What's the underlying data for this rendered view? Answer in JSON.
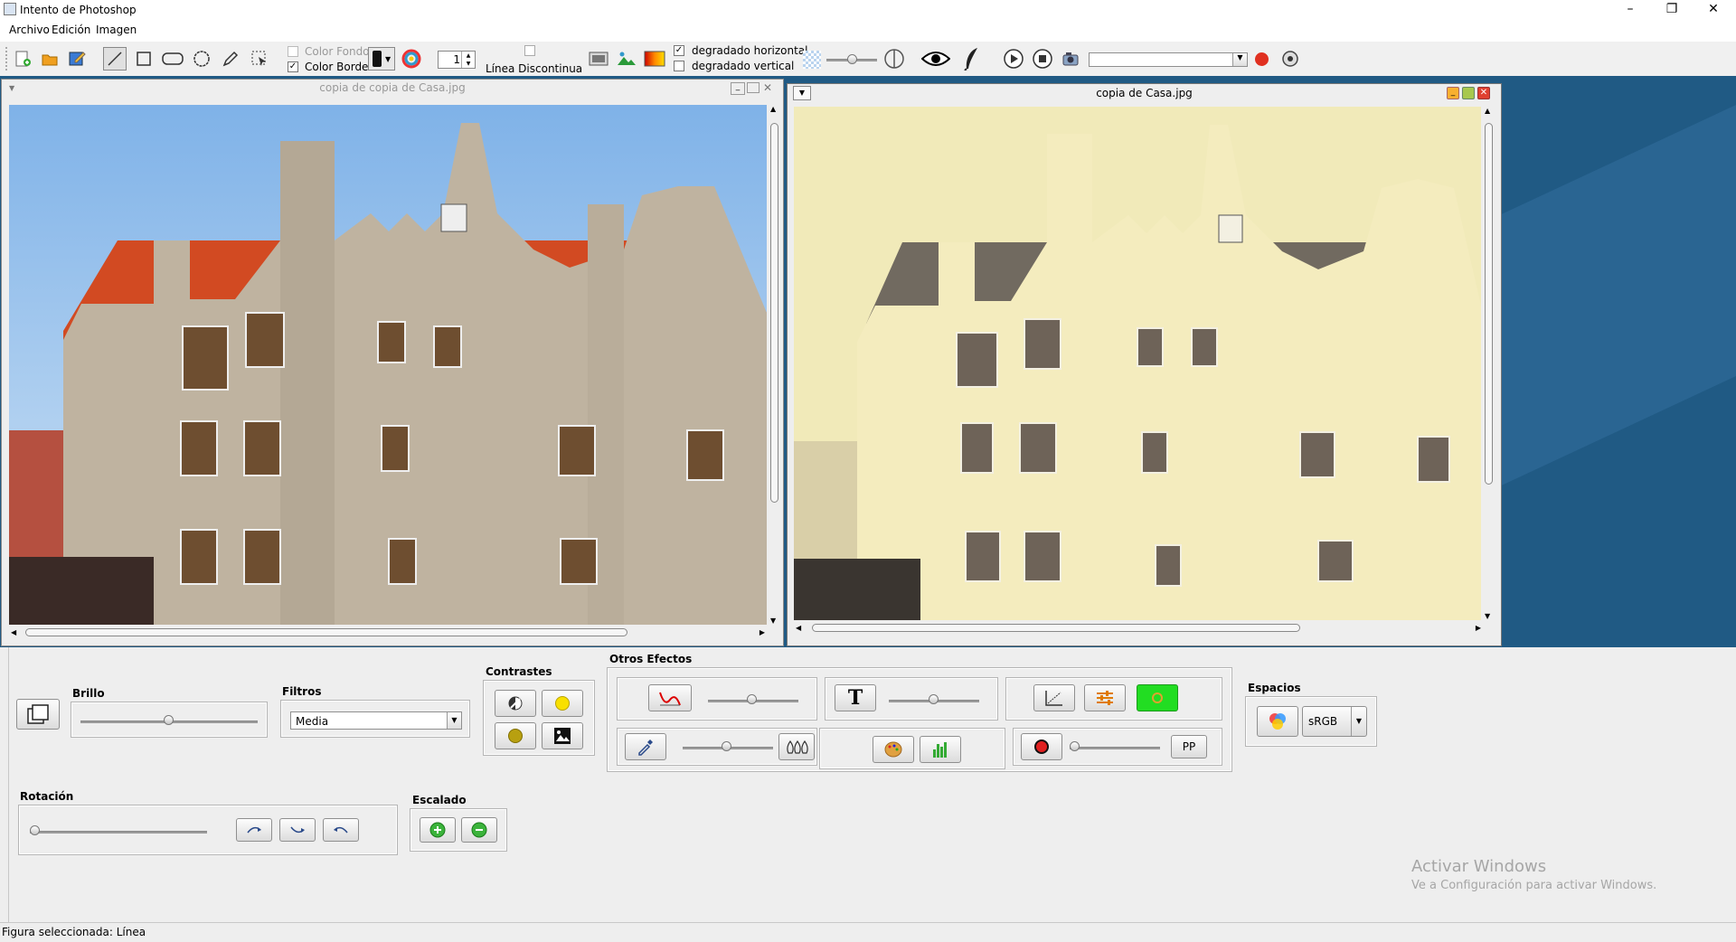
{
  "window": {
    "title": "Intento de Photoshop"
  },
  "menu": {
    "items": [
      "Archivo",
      "Edición",
      "Imagen"
    ]
  },
  "toolbar": {
    "color_fondo_label": "Color Fondo",
    "color_fondo_checked": false,
    "color_borde_label": "Color Borde",
    "color_borde_checked": true,
    "stroke_width_value": "1",
    "linea_discontinua_label": "Línea Discontinua",
    "linea_discontinua_checked": false,
    "degradado_horizontal_label": "degradado horizontal",
    "degradado_horizontal_checked": true,
    "degradado_vertical_label": "degradado vertical",
    "degradado_vertical_checked": false,
    "transparency_level": 0.5,
    "selected_tool": "line"
  },
  "frames": {
    "left": {
      "title": "copia de copia de Casa.jpg",
      "active": false
    },
    "right": {
      "title": "copia de Casa.jpg",
      "active": true
    }
  },
  "panels": {
    "brillo": {
      "label": "Brillo",
      "level": 0.5
    },
    "filtros": {
      "label": "Filtros",
      "selected": "Media"
    },
    "contrastes": {
      "label": "Contrastes"
    },
    "otros_efectos": {
      "label": "Otros Efectos",
      "pp_label": "PP"
    },
    "espacios": {
      "label": "Espacios",
      "selected": "sRGB"
    },
    "rotacion": {
      "label": "Rotación",
      "level": 0
    },
    "escalado": {
      "label": "Escalado"
    }
  },
  "watermark": {
    "line1": "Activar Windows",
    "line2": "Ve a Configuración para activar Windows."
  },
  "status": {
    "text": "Figura seleccionada: Línea"
  },
  "colors": {
    "desktop": "#205a84",
    "accent_red": "#e03020",
    "green_button": "#22dd22",
    "sepia": "#f1eab9"
  }
}
